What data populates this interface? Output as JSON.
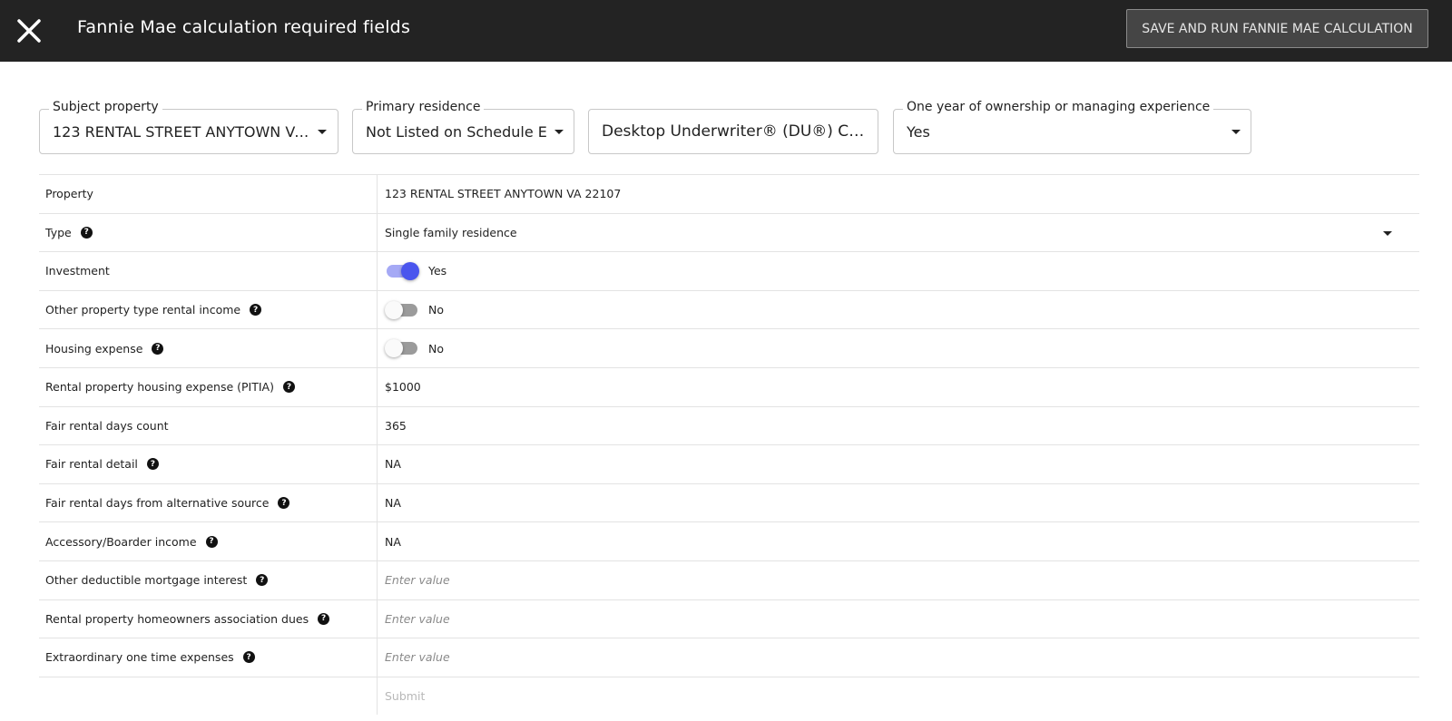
{
  "header": {
    "title": "Fannie Mae calculation required fields",
    "save_button": "SAVE AND RUN FANNIE MAE CALCULATION"
  },
  "filters": {
    "subject_property": {
      "label": "Subject property",
      "value": "123 RENTAL STREET ANYTOWN VA 2..."
    },
    "primary_residence": {
      "label": "Primary residence",
      "value": "Not Listed on Schedule E"
    },
    "calculation": {
      "value": "Desktop Underwriter® (DU®) Ca..."
    },
    "ownership_experience": {
      "label": "One year of ownership or managing experience",
      "value": "Yes"
    }
  },
  "rows": {
    "property": {
      "label": "Property",
      "value": "123 RENTAL STREET ANYTOWN VA 22107"
    },
    "type": {
      "label": "Type",
      "value": "Single family residence"
    },
    "investment": {
      "label": "Investment",
      "value": "Yes",
      "on": true
    },
    "other_property_type": {
      "label": "Other property type rental income",
      "value": "No",
      "on": false
    },
    "housing_expense": {
      "label": "Housing expense",
      "value": "No",
      "on": false
    },
    "pitia": {
      "label": "Rental property housing expense (PITIA)",
      "value": "$1000"
    },
    "fair_rental_days": {
      "label": "Fair rental days count",
      "value": "365"
    },
    "fair_rental_detail": {
      "label": "Fair rental detail",
      "value": "NA"
    },
    "fair_rental_alt": {
      "label": "Fair rental days from alternative source",
      "value": "NA"
    },
    "accessory_income": {
      "label": "Accessory/Boarder income",
      "value": "NA"
    },
    "mortgage_interest": {
      "label": "Other deductible mortgage interest",
      "placeholder": "Enter value"
    },
    "hoa_dues": {
      "label": "Rental property homeowners association dues",
      "placeholder": "Enter value"
    },
    "one_time_expenses": {
      "label": "Extraordinary one time expenses",
      "placeholder": "Enter value"
    },
    "submit": {
      "label": "Submit"
    }
  },
  "icons": {
    "close": "close-icon",
    "help": "help-circle-icon",
    "caret": "caret-down-icon"
  },
  "colors": {
    "header_bg": "#232323",
    "toggle_on": "#4a55ee",
    "toggle_off": "#9b9b9b"
  }
}
